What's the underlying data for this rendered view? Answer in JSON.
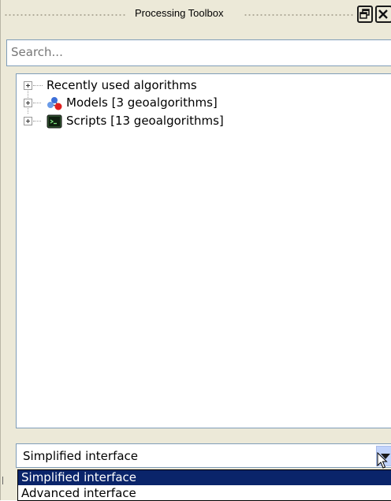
{
  "panel": {
    "title": "Processing Toolbox",
    "buttons": {
      "float": "float-icon",
      "close": "close-icon"
    }
  },
  "search": {
    "placeholder": "Search..."
  },
  "tree": {
    "items": [
      {
        "label": "Recently used algorithms",
        "icon": "none"
      },
      {
        "label": "Models [3 geoalgorithms]",
        "icon": "models-icon"
      },
      {
        "label": "Scripts [13 geoalgorithms]",
        "icon": "scripts-icon"
      }
    ]
  },
  "interface_select": {
    "value": "Simplified interface",
    "options": [
      "Simplified interface",
      "Advanced interface"
    ],
    "selected_index": 0
  },
  "colors": {
    "panel_bg": "#ece9d8",
    "field_border": "#7f9db9",
    "selection": "#0a246a"
  }
}
